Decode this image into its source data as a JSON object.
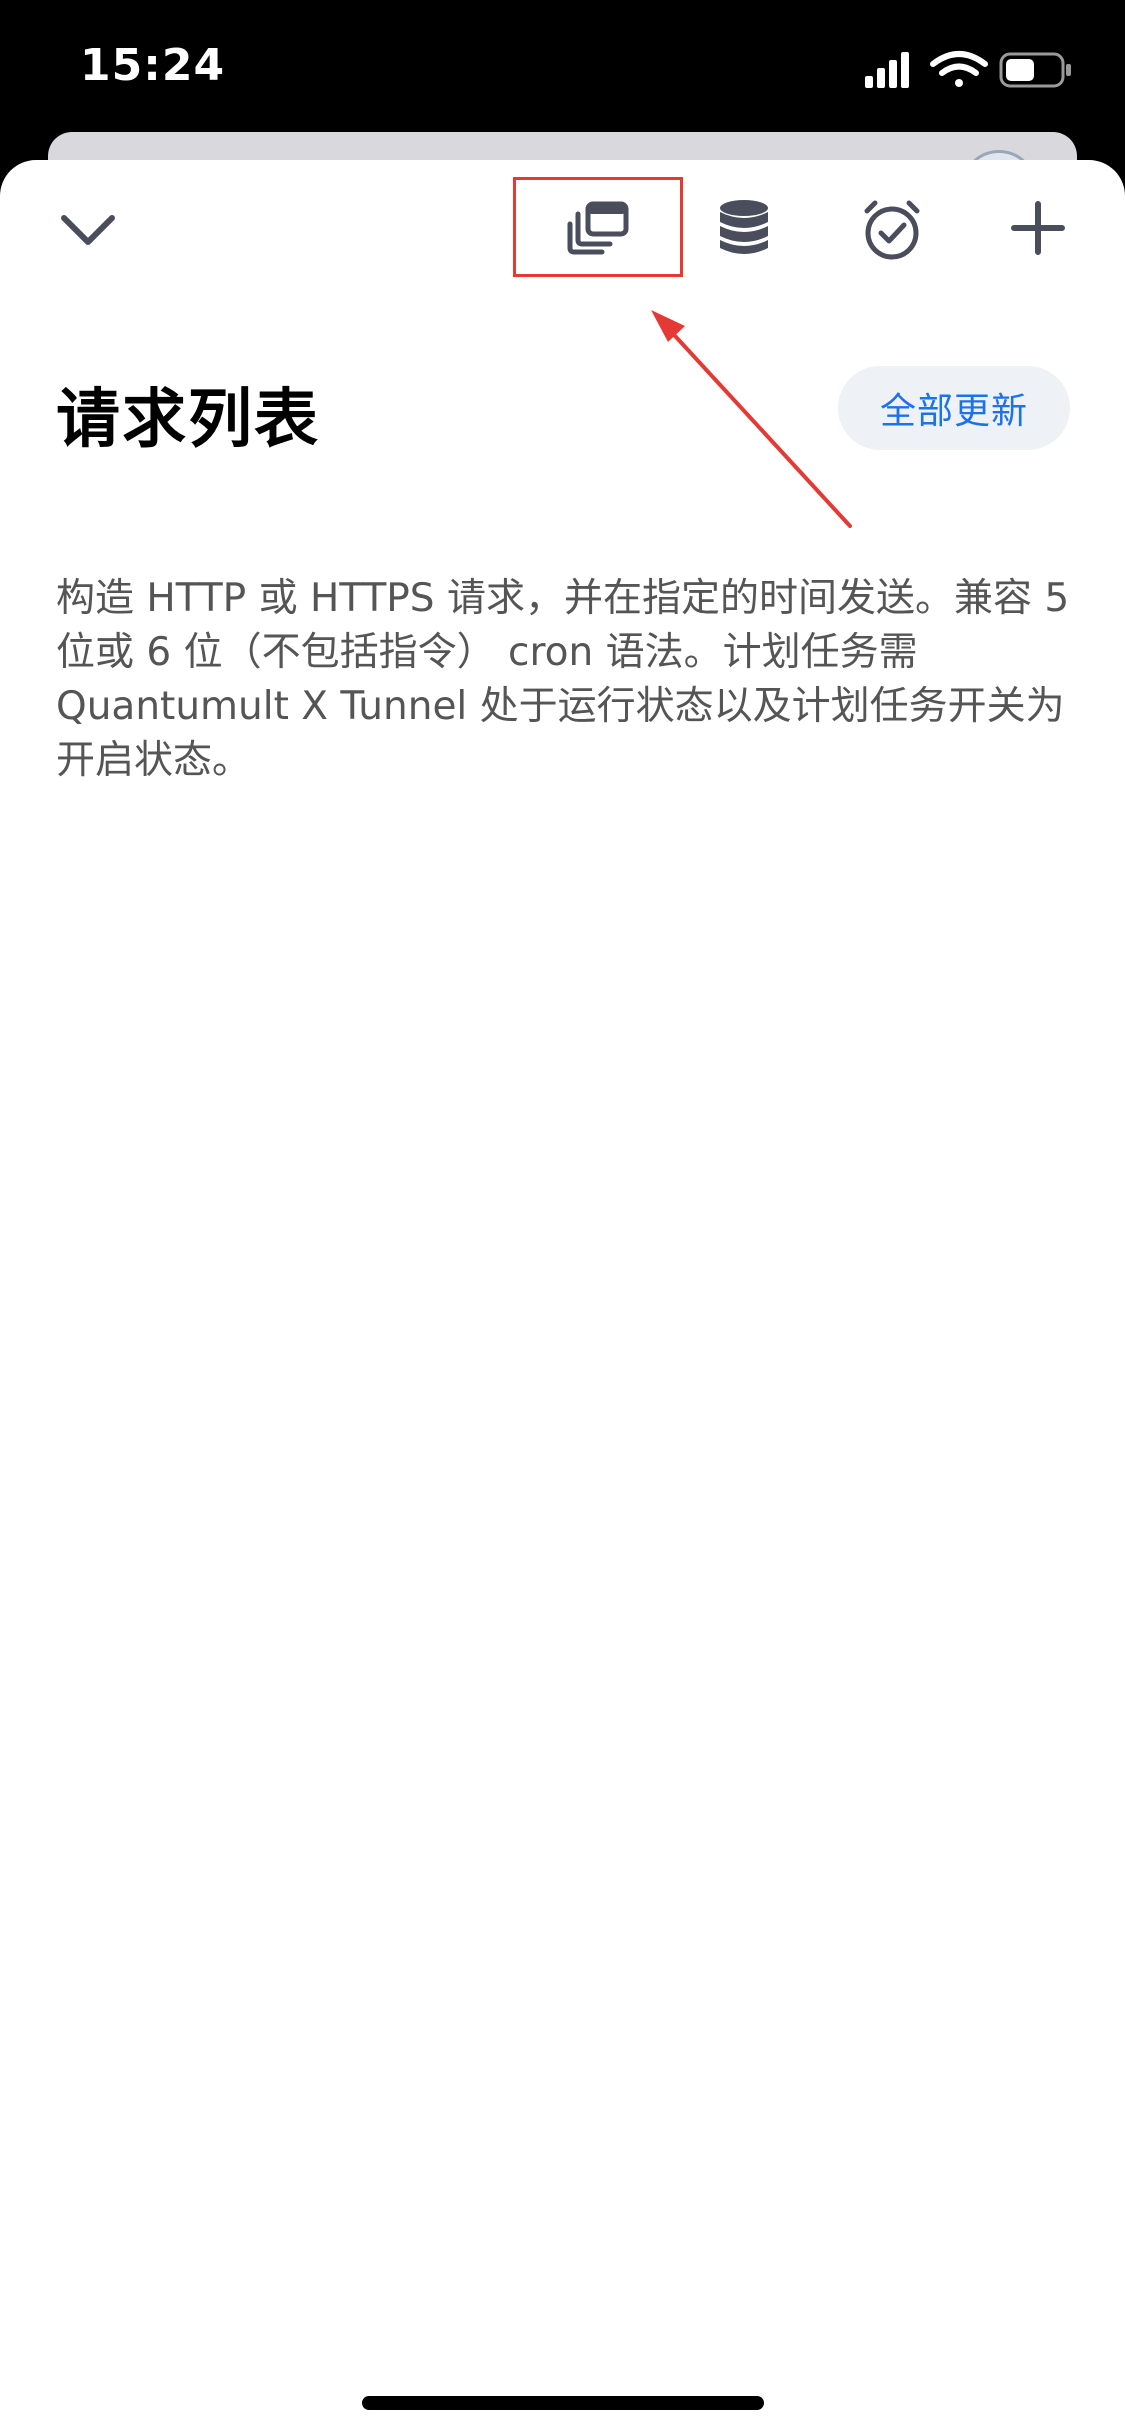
{
  "status_bar": {
    "time": "15:24",
    "icons": [
      "cellular-signal-icon",
      "wifi-icon",
      "battery-icon"
    ]
  },
  "toolbar": {
    "icons": [
      "chevron-down-icon",
      "multi-window-icon",
      "database-icon",
      "alarm-clock-icon",
      "plus-icon"
    ]
  },
  "header": {
    "title": "请求列表",
    "update_all_label": "全部更新"
  },
  "content": {
    "description": "构造 HTTP 或 HTTPS 请求，并在指定的时间发送。兼容 5 位或 6 位（不包括指令） cron 语法。计划任务需 Quantumult X Tunnel 处于运行状态以及计划任务开关为开启状态。"
  },
  "colors": {
    "accent": "#1a73e8",
    "annotation_red": "#e53935",
    "icon_gray": "#4a4e5c"
  }
}
